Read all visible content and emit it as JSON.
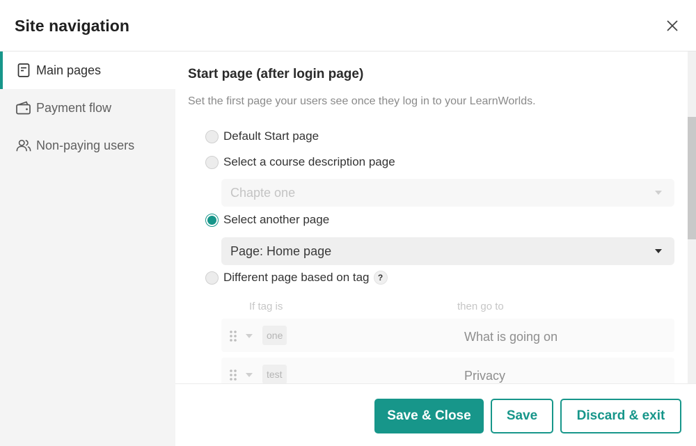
{
  "header": {
    "title": "Site navigation",
    "close_icon": "close-icon"
  },
  "sidebar": {
    "items": [
      {
        "label": "Main pages",
        "icon": "page-icon",
        "active": true
      },
      {
        "label": "Payment flow",
        "icon": "wallet-icon",
        "active": false
      },
      {
        "label": "Non-paying users",
        "icon": "users-icon",
        "active": false
      }
    ]
  },
  "main": {
    "section_title": "Start page (after login page)",
    "section_description": "Set the first page your users see once they log in to your LearnWorlds.",
    "options": [
      {
        "label": "Default Start page",
        "checked": false
      },
      {
        "label": "Select a course description page",
        "checked": false
      },
      {
        "label": "Select another page",
        "checked": true
      },
      {
        "label": "Different page based on tag",
        "checked": false
      }
    ],
    "course_select": {
      "value": "Chapte one",
      "disabled": true
    },
    "page_select": {
      "value": "Page: Home page",
      "disabled": false
    },
    "help_badge": "?",
    "tag_table": {
      "headers": [
        "If tag is",
        "then go to"
      ],
      "rows": [
        {
          "tag": "one",
          "destination": "What is going on"
        },
        {
          "tag": "test",
          "destination": "Privacy"
        }
      ]
    }
  },
  "footer": {
    "save_close_label": "Save & Close",
    "save_label": "Save",
    "discard_label": "Discard  & exit"
  },
  "colors": {
    "accent": "#17968a",
    "sidebar_bg": "#f4f4f4",
    "muted_text": "#8a8a8a"
  }
}
